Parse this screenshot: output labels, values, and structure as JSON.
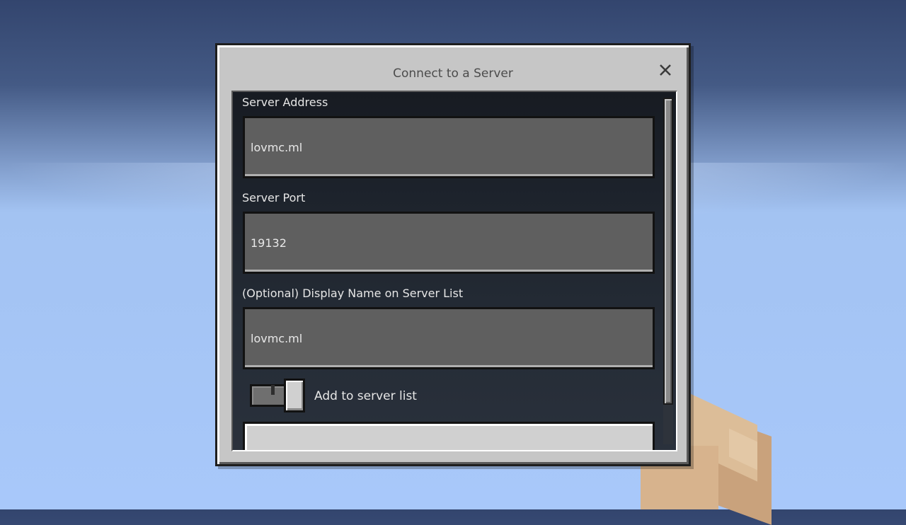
{
  "dialog": {
    "title": "Connect to a Server",
    "close_icon": "close-icon"
  },
  "form": {
    "server_address": {
      "label": "Server Address",
      "value": "lovmc.ml"
    },
    "server_port": {
      "label": "Server Port",
      "value": "19132"
    },
    "display_name": {
      "label": "(Optional) Display Name on Server List",
      "value": "lovmc.ml"
    },
    "add_to_list": {
      "label": "Add to server list",
      "checked": true
    }
  },
  "scrollbar": {
    "position": 0
  }
}
